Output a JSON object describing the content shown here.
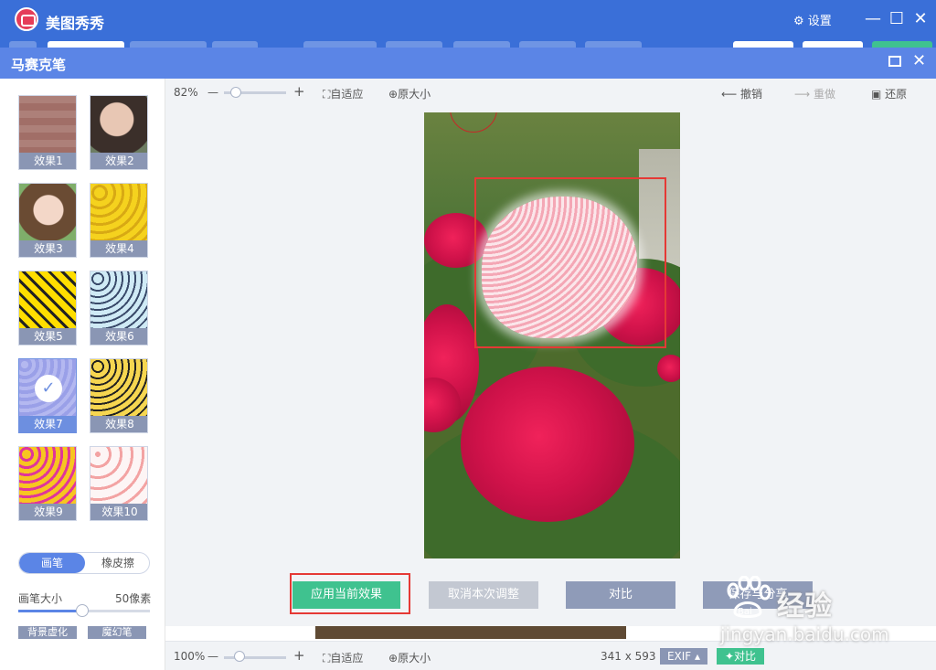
{
  "app": {
    "title": "美图秀秀",
    "settings": "设置"
  },
  "dialog": {
    "title": "马赛克笔"
  },
  "effects": [
    {
      "label": "效果1"
    },
    {
      "label": "效果2"
    },
    {
      "label": "效果3"
    },
    {
      "label": "效果4"
    },
    {
      "label": "效果5"
    },
    {
      "label": "效果6"
    },
    {
      "label": "效果7"
    },
    {
      "label": "效果8"
    },
    {
      "label": "效果9"
    },
    {
      "label": "效果10"
    }
  ],
  "selected_effect": "效果7",
  "brush": {
    "mode_brush": "画笔",
    "mode_eraser": "橡皮擦",
    "size_label": "画笔大小",
    "size_value": "50像素",
    "size_fraction": 0.5
  },
  "lower_buttons": {
    "bg_blur": "背景虚化",
    "magic": "魔幻笔"
  },
  "toolbar": {
    "zoom": "82%",
    "minus": "—",
    "plus": "+",
    "fit": "自适应",
    "original": "原大小",
    "undo": "撤销",
    "redo": "重做",
    "restore": "还原"
  },
  "actions": {
    "apply": "应用当前效果",
    "cancel": "取消本次调整",
    "compare": "对比",
    "save": "保存与分享"
  },
  "status": {
    "zoom": "100%",
    "minus": "—",
    "plus": "+",
    "fit": "自适应",
    "original": "原大小",
    "dimensions": "341 x 593",
    "exif": "EXIF ▴",
    "compare": "对比"
  },
  "watermark": {
    "brand": "Bai",
    "main": "经验",
    "url": "jingyan.baidu.com"
  },
  "colors": {
    "titlebar": "#3a6fd8",
    "dialog_bar": "#5b85e6",
    "apply": "#3fc28f",
    "highlight": "#e53935"
  }
}
